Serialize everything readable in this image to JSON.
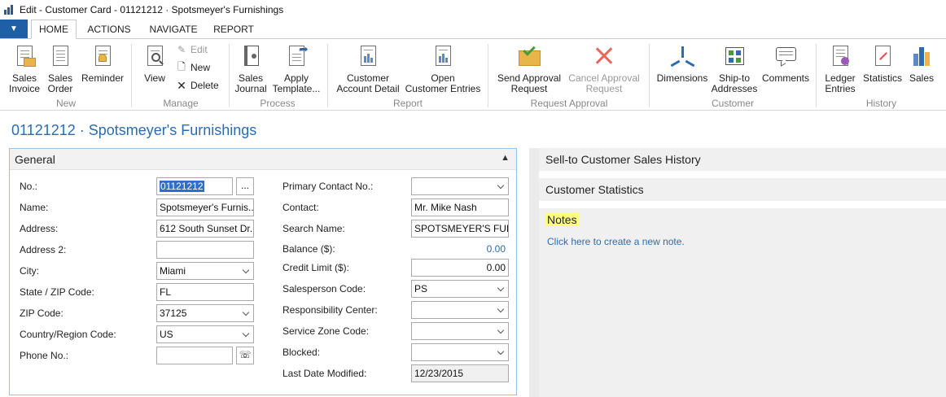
{
  "window": {
    "title": "Edit - Customer Card - 01121212 · Spotsmeyer's Furnishings"
  },
  "ribbon_tabs": [
    {
      "label": "HOME",
      "active": true
    },
    {
      "label": "ACTIONS",
      "active": false
    },
    {
      "label": "NAVIGATE",
      "active": false
    },
    {
      "label": "REPORT",
      "active": false
    }
  ],
  "ribbon": {
    "groups": {
      "new": "New",
      "manage": "Manage",
      "process": "Process",
      "report": "Report",
      "request_approval": "Request Approval",
      "customer": "Customer",
      "history": "History"
    },
    "buttons": {
      "sales_invoice": [
        "Sales",
        "Invoice"
      ],
      "sales_order": [
        "Sales",
        "Order"
      ],
      "reminder": [
        "Reminder"
      ],
      "view": [
        "View"
      ],
      "edit": "Edit",
      "new": "New",
      "delete": "Delete",
      "sales_journal": [
        "Sales",
        "Journal"
      ],
      "apply_template": [
        "Apply",
        "Template..."
      ],
      "customer_account_detail": [
        "Customer",
        "Account Detail"
      ],
      "open_customer_entries": [
        "Open",
        "Customer Entries"
      ],
      "send_approval_request": [
        "Send Approval",
        "Request"
      ],
      "cancel_approval_request": [
        "Cancel Approval",
        "Request"
      ],
      "dimensions": [
        "Dimensions"
      ],
      "ship_to_addresses": [
        "Ship-to",
        "Addresses"
      ],
      "comments": [
        "Comments"
      ],
      "ledger_entries": [
        "Ledger",
        "Entries"
      ],
      "statistics": [
        "Statistics"
      ],
      "sales": [
        "Sales"
      ]
    }
  },
  "page_title": "01121212 · Spotsmeyer's Furnishings",
  "general": {
    "title": "General",
    "left": {
      "no_label": "No.:",
      "no_value": "01121212",
      "no_assist": "...",
      "name_label": "Name:",
      "name_value": "Spotsmeyer's Furnis...",
      "address_label": "Address:",
      "address_value": "612 South Sunset Dr...",
      "address2_label": "Address 2:",
      "address2_value": "",
      "city_label": "City:",
      "city_value": "Miami",
      "state_label": "State / ZIP Code:",
      "state_value": "FL",
      "zip_label": "ZIP Code:",
      "zip_value": "37125",
      "country_label": "Country/Region Code:",
      "country_value": "US",
      "phone_label": "Phone No.:",
      "phone_value": ""
    },
    "right": {
      "primary_contact_label": "Primary Contact No.:",
      "primary_contact_value": "",
      "contact_label": "Contact:",
      "contact_value": "Mr. Mike Nash",
      "search_name_label": "Search Name:",
      "search_name_value": "SPOTSMEYER'S FUR...",
      "balance_label": "Balance ($):",
      "balance_value": "0.00",
      "credit_limit_label": "Credit Limit ($):",
      "credit_limit_value": "0.00",
      "salesperson_label": "Salesperson Code:",
      "salesperson_value": "PS",
      "responsibility_label": "Responsibility Center:",
      "responsibility_value": "",
      "service_zone_label": "Service Zone Code:",
      "service_zone_value": "",
      "blocked_label": "Blocked:",
      "blocked_value": "",
      "last_modified_label": "Last Date Modified:",
      "last_modified_value": "12/23/2015"
    }
  },
  "factboxes": {
    "sales_history": "Sell-to Customer Sales History",
    "statistics": "Customer Statistics",
    "notes": "Notes",
    "notes_link": "Click here to create a new note."
  },
  "colors": {
    "accent": "#2b6cb0",
    "app_menu": "#1f5fa8",
    "notes_highlight": "#ffff80"
  }
}
